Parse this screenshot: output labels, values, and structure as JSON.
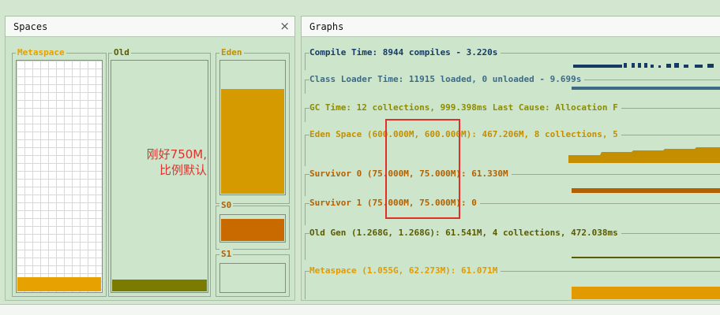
{
  "spaces": {
    "tab_label": "Spaces",
    "close_glyph": "×",
    "metaspace": {
      "label": "Metaspace",
      "fill_fraction": 0.06,
      "color": "#e7a100"
    },
    "old": {
      "label": "Old",
      "fill_fraction": 0.05,
      "color": "#7b7b00"
    },
    "eden": {
      "label": "Eden",
      "fill_fraction": 0.78,
      "color": "#d49a00"
    },
    "s0": {
      "label": "S0",
      "fill_fraction": 0.82,
      "color": "#c86a00"
    },
    "s1": {
      "label": "S1",
      "fill_fraction": 0.0,
      "color": "#c86a00"
    }
  },
  "annotation": {
    "line1": "刚好750M,",
    "line2": "比例默认",
    "color": "#e0302c"
  },
  "graphs": {
    "tab_label": "Graphs",
    "rows": [
      {
        "text": "Compile Time: 8944 compiles - 3.220s",
        "color": "#153b65"
      },
      {
        "text": "Class Loader Time: 11915 loaded, 0 unloaded - 9.699s",
        "color": "#3d6b86"
      },
      {
        "text": "GC Time: 12 collections, 999.398ms Last Cause: Allocation F",
        "color": "#8c8c00"
      },
      {
        "text": "Eden Space (600.000M, 600.000M): 467.206M, 8 collections, 5",
        "color": "#c48e00"
      },
      {
        "text": "Survivor 0 (75.000M, 75.000M): 61.330M",
        "color": "#b46000"
      },
      {
        "text": "Survivor 1 (75.000M, 75.000M): 0",
        "color": "#b46000"
      },
      {
        "text": "Old Gen (1.268G, 1.268G): 61.541M, 4 collections, 472.038ms",
        "color": "#5a5a00"
      },
      {
        "text": "Metaspace (1.055G, 62.273M): 61.071M",
        "color": "#e29a00"
      }
    ]
  }
}
